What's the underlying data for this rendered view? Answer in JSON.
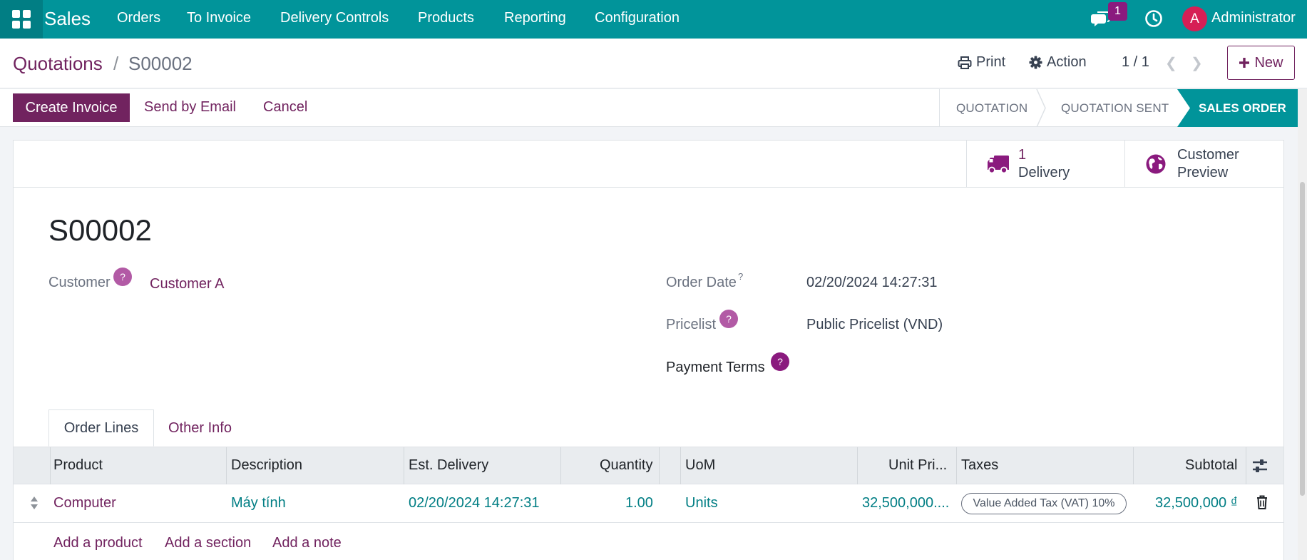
{
  "nav": {
    "app_name": "Sales",
    "menu": [
      "Orders",
      "To Invoice",
      "Delivery Controls",
      "Products",
      "Reporting",
      "Configuration"
    ],
    "messages_badge": "1",
    "avatar_initial": "A",
    "user_name": "Administrator"
  },
  "control": {
    "breadcrumb_parent": "Quotations",
    "breadcrumb_sep": "/",
    "breadcrumb_current": "S00002",
    "print_label": "Print",
    "action_label": "Action",
    "pager": "1 / 1",
    "new_label": "New"
  },
  "actions": {
    "create_invoice": "Create Invoice",
    "send_email": "Send by Email",
    "cancel": "Cancel"
  },
  "stages": {
    "quotation": "QUOTATION",
    "quotation_sent": "QUOTATION SENT",
    "sales_order": "SALES ORDER",
    "current": "SALES ORDER"
  },
  "smart_buttons": {
    "delivery_count": "1",
    "delivery_label": "Delivery",
    "preview_line1": "Customer",
    "preview_line2": "Preview"
  },
  "record": {
    "name": "S00002",
    "customer_label": "Customer",
    "customer_value": "Customer A",
    "order_date_label": "Order Date",
    "order_date_sup": "?",
    "order_date_value": "02/20/2024 14:27:31",
    "pricelist_label": "Pricelist",
    "pricelist_value": "Public Pricelist (VND)",
    "payment_terms_label": "Payment Terms",
    "help_glyph": "?"
  },
  "tabs": {
    "order_lines": "Order Lines",
    "other_info": "Other Info"
  },
  "table": {
    "headers": {
      "product": "Product",
      "description": "Description",
      "est_delivery": "Est. Delivery",
      "quantity": "Quantity",
      "uom": "UoM",
      "unit_price": "Unit Pri...",
      "taxes": "Taxes",
      "subtotal": "Subtotal"
    },
    "rows": [
      {
        "product": "Computer",
        "description": "Máy tính",
        "est_delivery": "02/20/2024 14:27:31",
        "quantity": "1.00",
        "uom": "Units",
        "unit_price": "32,500,000....",
        "tax": "Value Added Tax (VAT) 10%",
        "subtotal": "32,500,000 ₫"
      }
    ],
    "add_product": "Add a product",
    "add_section": "Add a section",
    "add_note": "Add a note"
  },
  "colors": {
    "nav_bg": "#01949a",
    "brand_purple": "#71235f",
    "link_teal": "#017e84",
    "avatar": "#d61f55"
  }
}
